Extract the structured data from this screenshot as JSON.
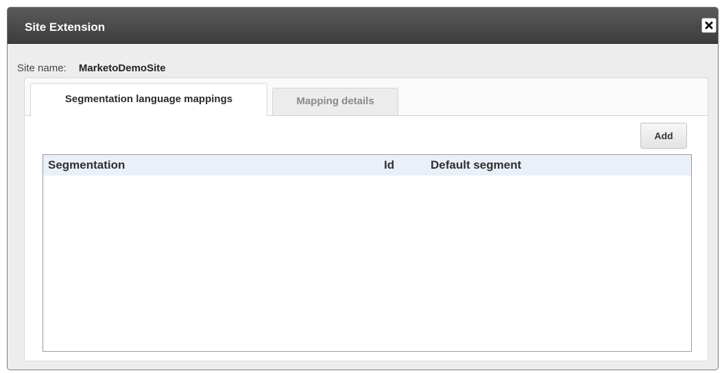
{
  "dialog": {
    "title": "Site Extension",
    "close_icon": "close-icon"
  },
  "site": {
    "label": "Site name:",
    "value": "MarketoDemoSite"
  },
  "tabs": [
    {
      "label": "Segmentation language mappings",
      "active": true
    },
    {
      "label": "Mapping details",
      "active": false
    }
  ],
  "toolbar": {
    "add_label": "Add"
  },
  "grid": {
    "columns": [
      "Segmentation",
      "Id",
      "Default segment"
    ],
    "rows": []
  }
}
